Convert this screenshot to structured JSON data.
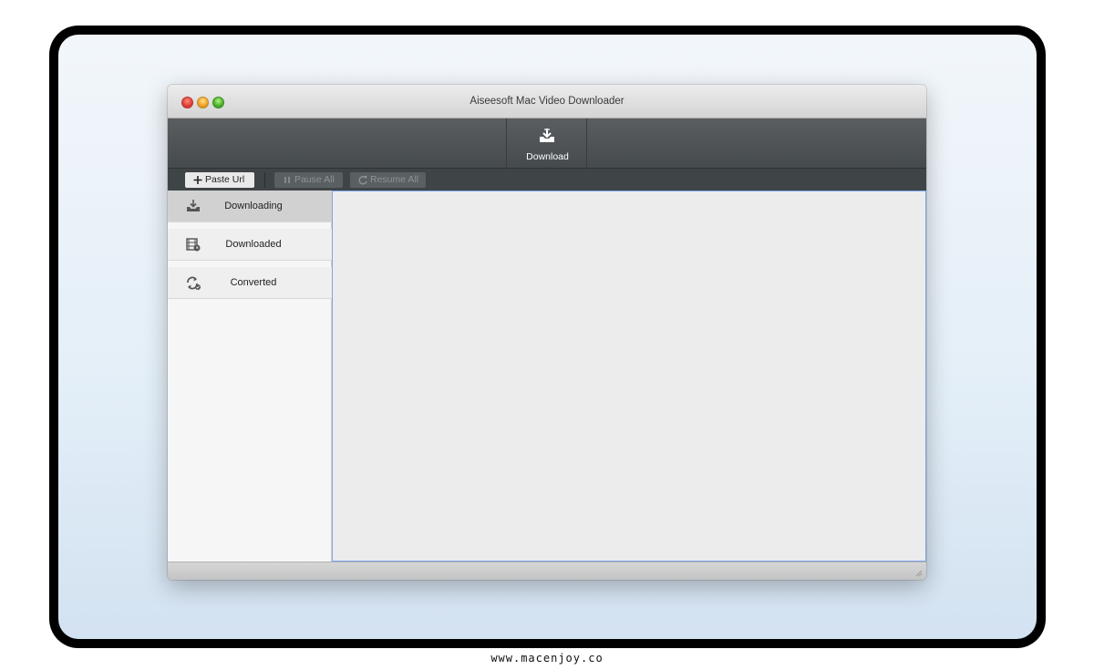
{
  "window": {
    "title": "Aiseesoft Mac Video Downloader"
  },
  "toolbar": {
    "download_label": "Download",
    "download_icon": "download-tray-icon"
  },
  "actions": {
    "paste_url": "Paste Url",
    "pause_all": "Pause All",
    "resume_all": "Resume All"
  },
  "sidebar": {
    "items": [
      {
        "label": "Downloading",
        "icon": "download-tray-icon",
        "active": true
      },
      {
        "label": "Downloaded",
        "icon": "film-clock-icon",
        "active": false
      },
      {
        "label": "Converted",
        "icon": "convert-arrows-icon",
        "active": false
      }
    ]
  },
  "watermark": "www.macenjoy.co",
  "colors": {
    "toolbar": "#4f5457",
    "selection_border": "#7ea6e8",
    "active_item": "#d1d1d1"
  }
}
